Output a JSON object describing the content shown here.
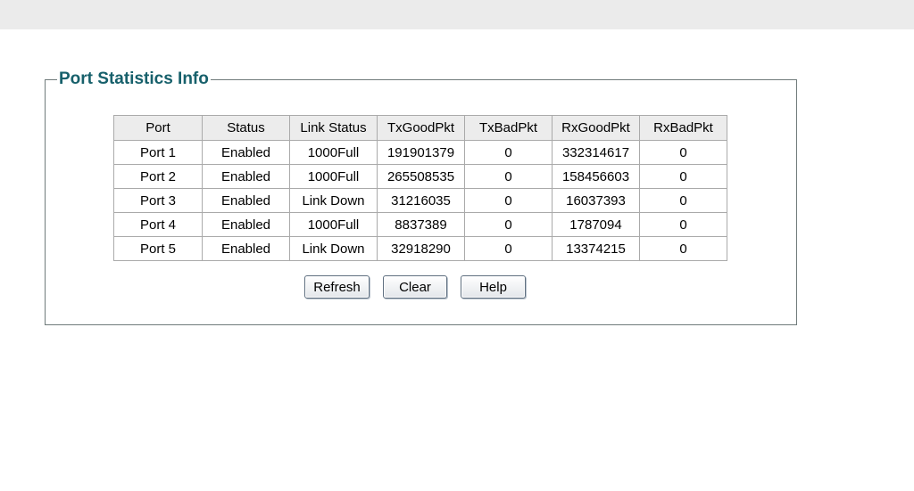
{
  "section": {
    "title": "Port Statistics Info"
  },
  "table": {
    "headers": [
      "Port",
      "Status",
      "Link Status",
      "TxGoodPkt",
      "TxBadPkt",
      "RxGoodPkt",
      "RxBadPkt"
    ],
    "rows": [
      [
        "Port 1",
        "Enabled",
        "1000Full",
        "191901379",
        "0",
        "332314617",
        "0"
      ],
      [
        "Port 2",
        "Enabled",
        "1000Full",
        "265508535",
        "0",
        "158456603",
        "0"
      ],
      [
        "Port 3",
        "Enabled",
        "Link Down",
        "31216035",
        "0",
        "16037393",
        "0"
      ],
      [
        "Port 4",
        "Enabled",
        "1000Full",
        "8837389",
        "0",
        "1787094",
        "0"
      ],
      [
        "Port 5",
        "Enabled",
        "Link Down",
        "32918290",
        "0",
        "13374215",
        "0"
      ]
    ]
  },
  "buttons": {
    "refresh": "Refresh",
    "clear": "Clear",
    "help": "Help"
  },
  "colors": {
    "title": "#17606b",
    "header_bg": "#ececec",
    "topbar": "#ebebeb"
  }
}
